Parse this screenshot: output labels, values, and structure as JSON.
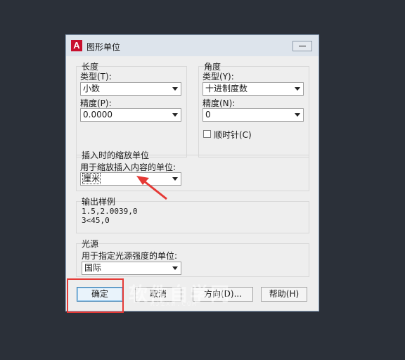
{
  "title": "图形单位",
  "app_logo_letter": "A",
  "length": {
    "group_title": "长度",
    "type_label": "类型(T):",
    "type_value": "小数",
    "precision_label": "精度(P):",
    "precision_value": "0.0000"
  },
  "angle": {
    "group_title": "角度",
    "type_label": "类型(Y):",
    "type_value": "十进制度数",
    "precision_label": "精度(N):",
    "precision_value": "0",
    "clockwise_label": "顺时针(C)",
    "clockwise_checked": false
  },
  "insert": {
    "group_title": "插入时的缩放单位",
    "label": "用于缩放插入内容的单位:",
    "value": "厘米"
  },
  "sample": {
    "group_title": "输出样例",
    "line1": "1.5,2.0039,0",
    "line2": "3<45,0"
  },
  "lighting": {
    "group_title": "光源",
    "label": "用于指定光源强度的单位:",
    "value": "国际"
  },
  "buttons": {
    "ok": "确定",
    "cancel": "取消",
    "direction": "方向(D)...",
    "help": "帮助(H)"
  },
  "watermark": {
    "text": "软件自学网",
    "sub": "RJZXW.COM"
  },
  "annotation_color": "#e53935"
}
